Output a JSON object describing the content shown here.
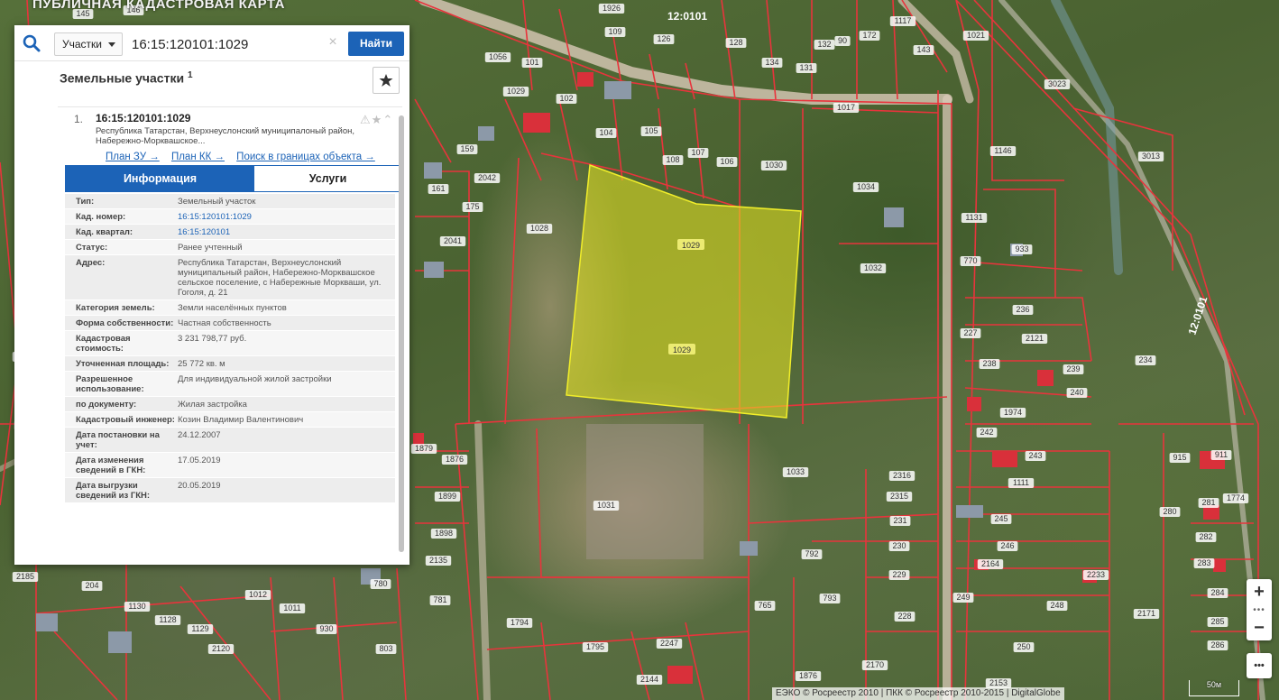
{
  "app": {
    "title": "ПУБЛИЧНАЯ КАДАСТРОВАЯ КАРТА"
  },
  "search": {
    "type_select": "Участки",
    "query": "16:15:120101:1029",
    "find_label": "Найти"
  },
  "results": {
    "title": "Земельные участки",
    "count": "1",
    "item": {
      "number": "1.",
      "id": "16:15:120101:1029",
      "address_short": "Республика Татарстан, Верхнеуслонский муниципалоный район, Набережно-Моркв­ашское...",
      "links": [
        "План ЗУ →",
        "План КК →",
        "Поиск в границах объекта →"
      ],
      "tabs": {
        "info": "Информация",
        "services": "Услуги"
      },
      "fields": [
        {
          "key": "Тип:",
          "value": "Земельный участок"
        },
        {
          "key": "Кад. номер:",
          "value": "16:15:120101:1029"
        },
        {
          "key": "Кад. квартал:",
          "value": "16:15:120101"
        },
        {
          "key": "Статус:",
          "value": "Ранее учтенный"
        },
        {
          "key": "Адрес:",
          "value": "Республика Татарстан, Верхнеуслонский муниципальный район, Набережно-Моркв­ашское сельское поселение, с Набережные Моркваши, ул. Гоголя, д. 21"
        },
        {
          "key": "Категория земель:",
          "value": "Земли населённых пунктов"
        },
        {
          "key": "Форма собственности:",
          "value": "Частная собственность"
        },
        {
          "key": "Кадастровая стоимость:",
          "value": "3 231 798,77 руб."
        },
        {
          "key": "Уточненная площадь:",
          "value": "25 772 кв. м"
        },
        {
          "key": "Разрешенное использование:",
          "value": "Для индивидуальной жилой застройки"
        },
        {
          "key": "по документу:",
          "value": "Жилая застройка"
        },
        {
          "key": "Кадастровый инженер:",
          "value": "Козин Владимир Валентинович"
        },
        {
          "key": "Дата постановки на учет:",
          "value": "24.12.2007"
        },
        {
          "key": "Дата изменения сведений в ГКН:",
          "value": "17.05.2019"
        },
        {
          "key": "Дата выгрузки сведений из ГКН:",
          "value": "20.05.2019"
        }
      ]
    }
  },
  "map": {
    "attribution": "ЕЭКО © Росреестр 2010 | ПКК © Росреестр 2010-2015 | DigitalGlobe",
    "scale_label": "50м",
    "zoom_in": "+",
    "zoom_out": "−",
    "more": "•••",
    "selected_parcel_label": "1029",
    "quarter_labels": [
      "12:0101",
      "12:0101"
    ],
    "parcel_labels": [
      "145",
      "146",
      "1926",
      "109",
      "126",
      "128",
      "134",
      "131",
      "132",
      "90",
      "1117",
      "172",
      "143",
      "1021",
      "3023",
      "2157",
      "1029",
      "1056",
      "101",
      "102",
      "104",
      "105",
      "108",
      "107",
      "106",
      "1030",
      "1017",
      "1034",
      "1146",
      "3013",
      "159",
      "161",
      "175",
      "2041",
      "2042",
      "1028",
      "1032",
      "1131",
      "933",
      "770",
      "236",
      "2121",
      "227",
      "238",
      "239",
      "240",
      "234",
      "1974",
      "242",
      "243",
      "1111",
      "1033",
      "2316",
      "2315",
      "231",
      "230",
      "229",
      "228",
      "245",
      "246",
      "2164",
      "2233",
      "248",
      "249",
      "250",
      "2171",
      "282",
      "283",
      "284",
      "285",
      "286",
      "281",
      "1774",
      "911",
      "915",
      "280",
      "2012",
      "1249",
      "2075",
      "218",
      "2185",
      "204",
      "1130",
      "1128",
      "1129",
      "2120",
      "930",
      "1011",
      "1012",
      "803",
      "1898",
      "1899",
      "2135",
      "780",
      "781",
      "765",
      "792",
      "793",
      "1794",
      "1795",
      "2247",
      "2144",
      "1876",
      "2170",
      "2153",
      "1031",
      "1879",
      "1876"
    ]
  }
}
